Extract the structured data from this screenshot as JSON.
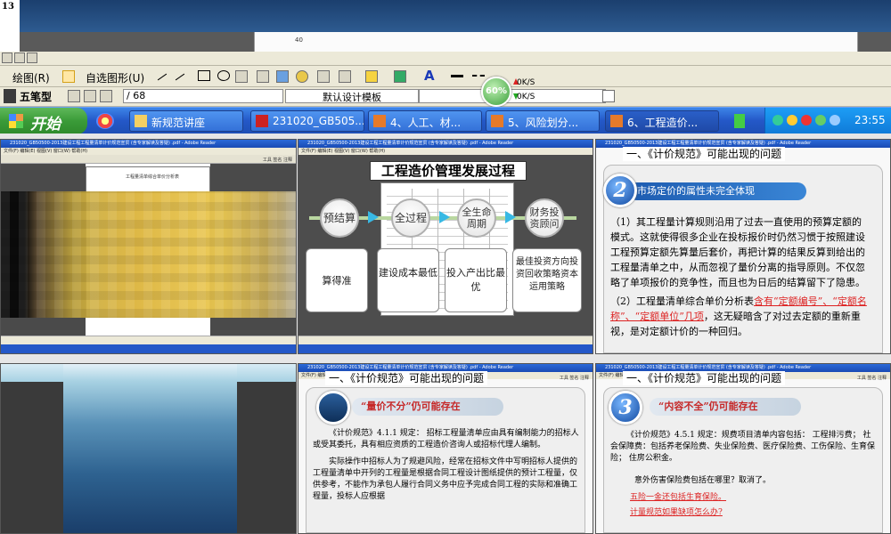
{
  "top": {
    "slide_number": "13",
    "field_value": "40"
  },
  "ppt": {
    "draw_label": "绘图(R)",
    "autoshape_label": "自选图形(U)",
    "wubi_label": "五笔型",
    "page_value": "/ 68",
    "template_label": "默认设计模板",
    "net_percent": "60%",
    "net_up": "0K/S",
    "net_down": "0K/S"
  },
  "taskbar": {
    "start_label": "开始",
    "tasks": [
      {
        "label": "新规范讲座"
      },
      {
        "label": "231020_GB505..."
      },
      {
        "label": "4、人工、材..."
      },
      {
        "label": "5、风险划分..."
      },
      {
        "label": "6、工程造价..."
      }
    ],
    "time": "23:55"
  },
  "thumbs": {
    "adobe_title": "231020_GB50500-2013建设工程工程量清单计价规范宣贯 (含专家解读及答疑) .pdf - Adobe Reader",
    "adobe_menu": "文件(F) 编辑(E) 视图(V) 窗口(W) 帮助(H)",
    "adobe_tools": "工具  签名  注释",
    "s1_doc_title": "工程量清单综合单价分析表",
    "s2": {
      "title": "工程造价管理发展过程",
      "circles": [
        "预结算",
        "全过程",
        "全生命周期",
        "财务投资顾问"
      ],
      "boxes": [
        "算得准",
        "建设成本最低",
        "投入产出比最优",
        "最佳投资方向投资回收策略资本运用策略"
      ]
    },
    "s3": {
      "heading": "一、《计价规范》可能出现的问题",
      "badge": "2",
      "banner": "市场定价的属性未完全体现",
      "para1": "（1）其工程量计算规则沿用了过去一直使用的预算定额的模式。这就使得很多企业在投标报价时仍然习惯于按照建设工程预算定额先算量后套价，再把计算的结果反算到给出的工程量清单之中，从而忽视了量价分离的指导原则。不仅忽略了单项报价的竞争性，而且也为日后的结算留下了隐患。",
      "para2_a": "（2）工程量清单综合单价分析表",
      "para2_red": "含有“定额编号”、“定额名称”、“定额单位”几项",
      "para2_b": "，这无疑暗含了对过去定额的重新重视，是对定额计价的一种回归。"
    },
    "s5": {
      "heading": "一、《计价规范》可能出现的问题",
      "banner": "“量价不分”仍可能存在",
      "para1": "《计价规范》4.1.1 规定： 招标工程量清单应由具有编制能力的招标人或受其委托，具有相应资质的工程造价咨询人或招标代理人编制。",
      "para2": "实际操作中招标人为了规避风险，经常在招标文件中写明招标人提供的工程量清单中开列的工程量是根据合同工程设计图纸提供的预计工程量，仅供参考，不能作为承包人履行合同义务中应予完成合同工程的实际和准确工程量，投标人应根据"
    },
    "s6": {
      "heading": "一、《计价规范》可能出现的问题",
      "badge": "3",
      "banner": "“内容不全”仍可能存在",
      "para1": "《计价规范》4.5.1 规定：规费项目清单内容包括： 工程排污费； 社会保障费：包括养老保险费、失业保险费、医疗保险费、工伤保险、生育保险； 住房公积金。",
      "para2": "意外伤害保险费包括在哪里？取消了。",
      "link1": "五险一金还包括生育保险。",
      "link2": "计量规范如果缺项怎么办?"
    }
  }
}
